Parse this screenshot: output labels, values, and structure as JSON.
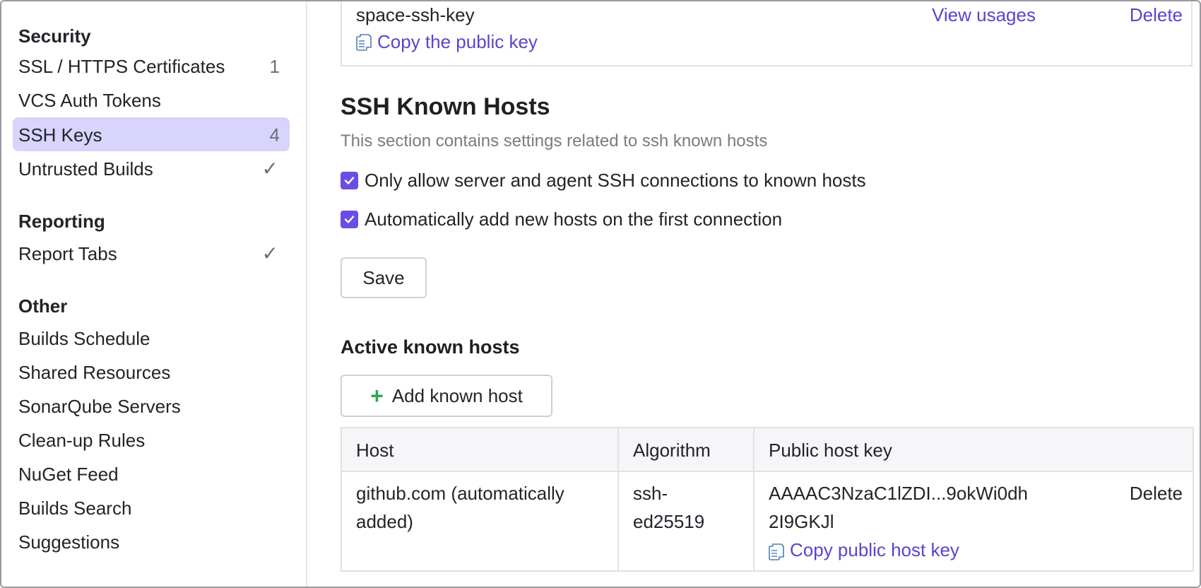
{
  "sidebar": {
    "security": {
      "title": "Security",
      "items": [
        {
          "label": "SSL / HTTPS Certificates",
          "badge": "1"
        },
        {
          "label": "VCS Auth Tokens"
        },
        {
          "label": "SSH Keys",
          "badge": "4"
        },
        {
          "label": "Untrusted Builds",
          "check": "✓"
        }
      ]
    },
    "reporting": {
      "title": "Reporting",
      "items": [
        {
          "label": "Report Tabs",
          "check": "✓"
        }
      ]
    },
    "other": {
      "title": "Other",
      "items": [
        {
          "label": "Builds Schedule"
        },
        {
          "label": "Shared Resources"
        },
        {
          "label": "SonarQube Servers"
        },
        {
          "label": "Clean-up Rules"
        },
        {
          "label": "NuGet Feed"
        },
        {
          "label": "Builds Search"
        },
        {
          "label": "Suggestions"
        }
      ]
    }
  },
  "ssh_key": {
    "name": "space-ssh-key",
    "copy_label": "Copy the public key",
    "view_usages": "View usages",
    "delete": "Delete"
  },
  "known_hosts": {
    "title": "SSH Known Hosts",
    "description": "This section contains settings related to ssh known hosts",
    "only_allow_label": "Only allow server and agent SSH connections to known hosts",
    "only_allow_checked": true,
    "auto_add_label": "Automatically add new hosts on the first connection",
    "auto_add_checked": true,
    "save_label": "Save",
    "active_title": "Active known hosts",
    "add_label": "Add known host",
    "table": {
      "headers": [
        "Host",
        "Algorithm",
        "Public host key"
      ],
      "rows": [
        {
          "host_line1": "github.com (automatically",
          "host_line2": "added)",
          "algo_line1": "ssh-",
          "algo_line2": "ed25519",
          "key_line1": "AAAAC3NzaC1lZDI...9okWi0dh",
          "key_line2": "2I9GKJl",
          "copy_label": "Copy public host key",
          "delete": "Delete"
        }
      ]
    }
  },
  "colors": {
    "accent": "#6b4de6",
    "link": "#5a44d0",
    "active_item_bg": "#d8d4fb",
    "add_icon": "#2fa84f"
  }
}
